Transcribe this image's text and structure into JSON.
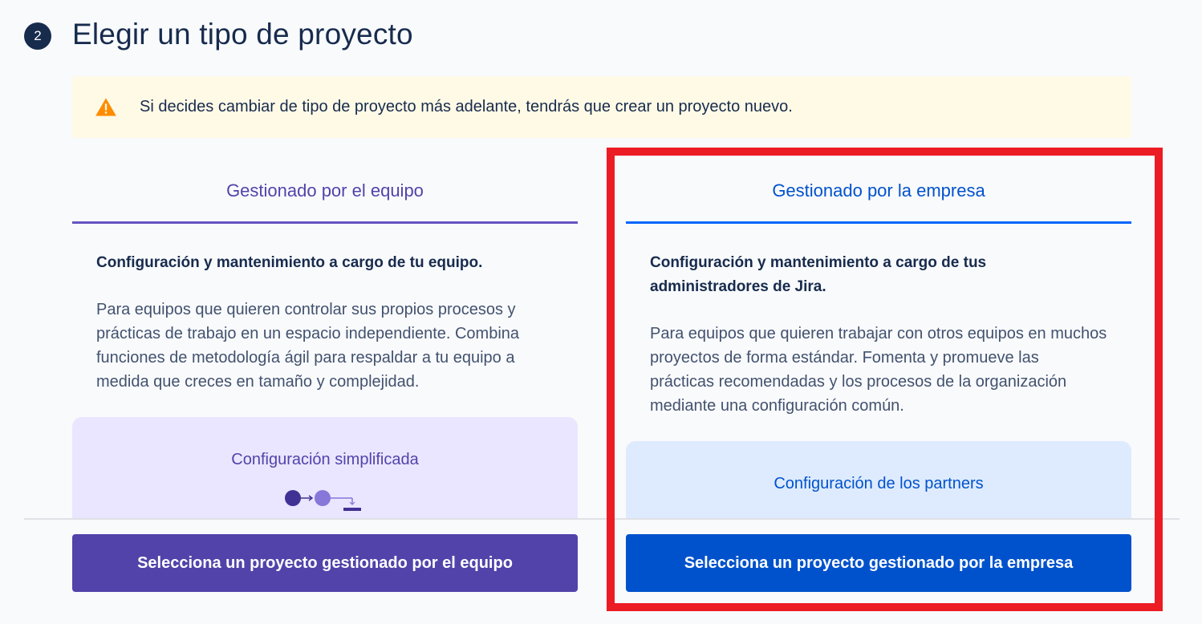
{
  "header": {
    "step_number": "2",
    "title": "Elegir un tipo de proyecto"
  },
  "warning": {
    "icon": "warning-triangle-icon",
    "text": "Si decides cambiar de tipo de proyecto más adelante, tendrás que crear un proyecto nuevo."
  },
  "team_managed": {
    "tab_label": "Gestionado por el equipo",
    "subtitle": "Configuración y mantenimiento a cargo de tu equipo.",
    "description": "Para equipos que quieren controlar sus propios procesos y prácticas de trabajo en un espacio independiente. Combina funciones de metodología ágil para respaldar a tu equipo a medida que creces en tamaño y complejidad.",
    "feature_title": "Configuración simplificada",
    "button_label": "Selecciona un proyecto gestionado por el equipo",
    "accent_color": "#5243aa"
  },
  "company_managed": {
    "tab_label": "Gestionado por la empresa",
    "subtitle": "Configuración y mantenimiento a cargo de tus administradores de Jira.",
    "description": "Para equipos que quieren trabajar con otros equipos en muchos proyectos de forma estándar. Fomenta y promueve las prácticas recomendadas y los procesos de la organización mediante una configuración común.",
    "feature_title": "Configuración de los partners",
    "button_label": "Selecciona un proyecto gestionado por la empresa",
    "accent_color": "#0052cc"
  },
  "highlight_color": "#ec1c24"
}
